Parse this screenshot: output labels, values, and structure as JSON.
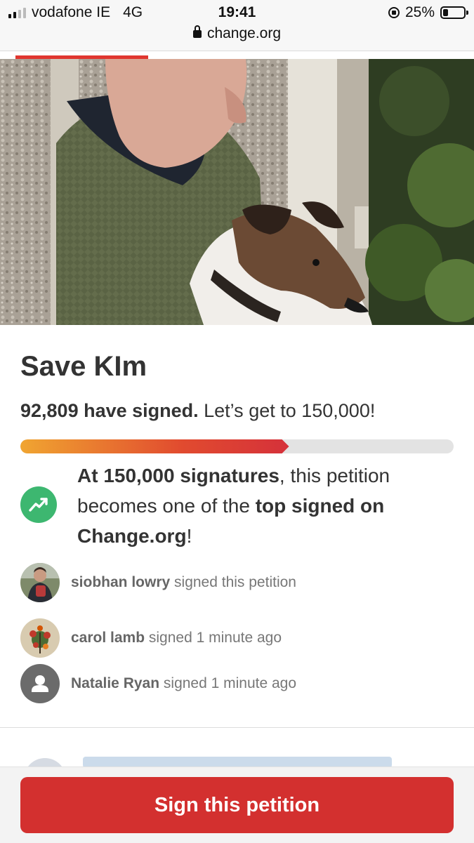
{
  "status_bar": {
    "carrier": "vodafone IE",
    "network": "4G",
    "time": "19:41",
    "battery": "25%",
    "battery_level": 0.25,
    "signal_bars": 2
  },
  "browser": {
    "url": "change.org",
    "page_load_fraction": 0.3
  },
  "petition": {
    "title": "Save KIm",
    "signed_count_text": "92,809 have signed.",
    "goal_text": " Let’s get to 150,000!",
    "signed": 92809,
    "goal": 150000,
    "progress_fraction": 0.62,
    "milestone": {
      "part1_bold": "At 150,000 signatures",
      "part2": ", this petition becomes one of the ",
      "part3_bold": "top signed on Change.org",
      "part4": "!"
    }
  },
  "recent_signers": [
    {
      "name": "siobhan lowry",
      "action": " signed this petition",
      "avatar": "photo-person"
    },
    {
      "name": "carol lamb",
      "action": " signed 1 minute ago",
      "avatar": "photo-flowers"
    },
    {
      "name": "Natalie Ryan",
      "action": " signed 1 minute ago",
      "avatar": "default-user-icon"
    }
  ],
  "cta": {
    "label": "Sign this petition",
    "color": "#d3302f"
  },
  "colors": {
    "milestone_green": "#3db770",
    "progress_start": "#f0a531",
    "progress_end": "#d5313a"
  }
}
